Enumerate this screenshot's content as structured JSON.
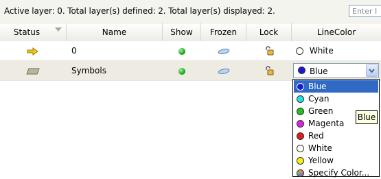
{
  "info_bar": {
    "status_text": "Active layer: 0. Total layer(s) defined: 2. Total layer(s) displayed: 2.",
    "filter_placeholder": "Enter I"
  },
  "columns": [
    {
      "label": "Status"
    },
    {
      "label": "Name"
    },
    {
      "label": "Show"
    },
    {
      "label": "Frozen"
    },
    {
      "label": "Lock"
    },
    {
      "label": "LineColor"
    }
  ],
  "layers": [
    {
      "status_icon": "arrow-right-icon",
      "name": "0",
      "show": true,
      "frozen_icon": "sun-icon",
      "lock_icon": "unlocked-padlock-icon",
      "line_color": "White",
      "line_color_hex": "#ffffff"
    },
    {
      "status_icon": "layer-icon",
      "name": "Symbols",
      "show": true,
      "frozen_icon": "sun-icon",
      "lock_icon": "unlocked-padlock-icon",
      "line_color": "Blue",
      "line_color_hex": "#1a1ad6"
    }
  ],
  "color_dropdown": {
    "selected": "Blue",
    "options": [
      {
        "label": "Blue",
        "hex": "#1a1ad6"
      },
      {
        "label": "Cyan",
        "hex": "#22e0e0"
      },
      {
        "label": "Green",
        "hex": "#1fc21f"
      },
      {
        "label": "Magenta",
        "hex": "#e020e0"
      },
      {
        "label": "Red",
        "hex": "#e01c1c"
      },
      {
        "label": "White",
        "hex": "#ffffff"
      },
      {
        "label": "Yellow",
        "hex": "#f2f21a"
      },
      {
        "label": "Specify Color...",
        "hex": "#d08aa8"
      }
    ]
  },
  "tooltip": {
    "text": "Blue"
  },
  "colors": {
    "selection": "#316ac5",
    "header_bg": "#ecebe4",
    "row_alt": "#edebe2"
  }
}
